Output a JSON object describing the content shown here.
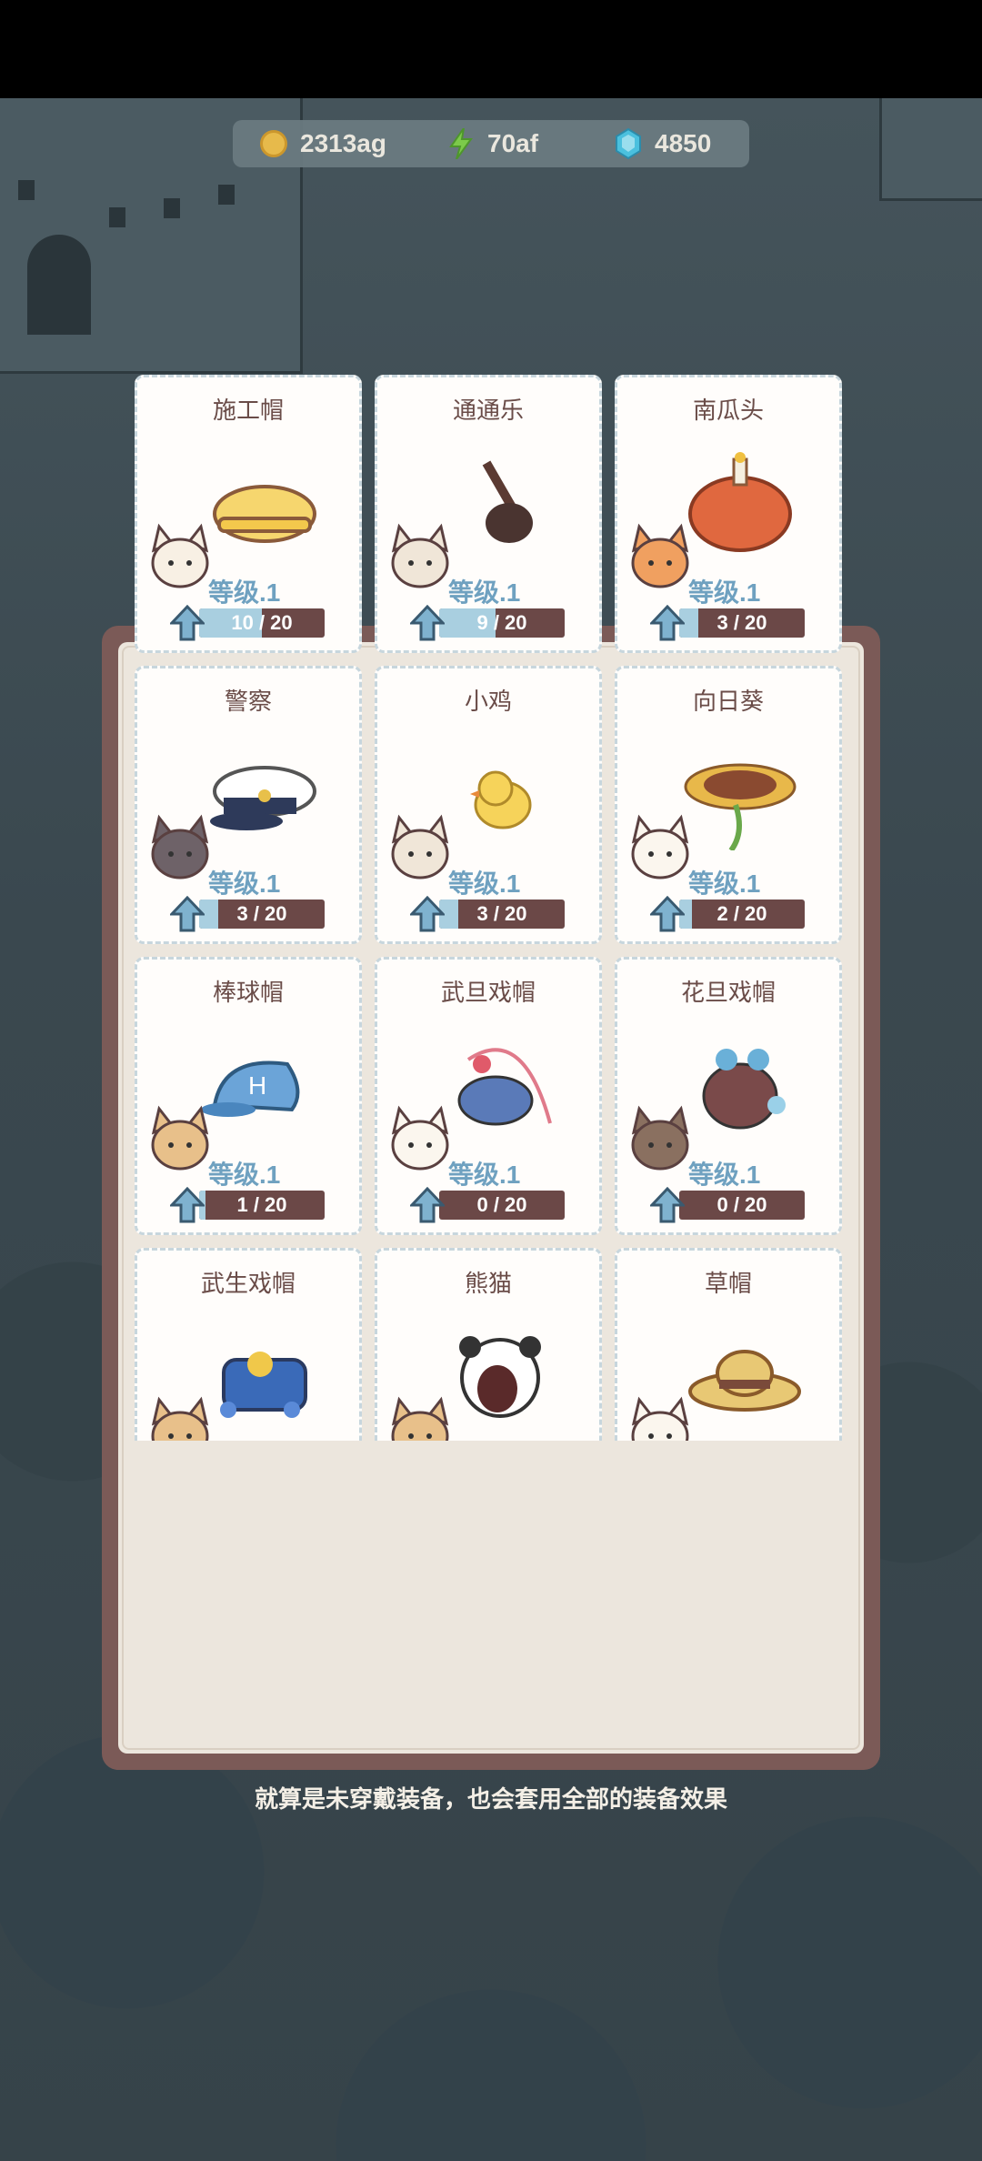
{
  "currency": {
    "coins": {
      "icon": "coin-icon",
      "value": "2313ag"
    },
    "energy": {
      "icon": "lightning-icon",
      "value": "70af"
    },
    "gems": {
      "icon": "gem-icon",
      "value": "4850"
    }
  },
  "items": [
    {
      "name": "施工帽",
      "level": "等级.1",
      "progress": "10 / 20",
      "fraction": 0.5,
      "hat": "hard-hat",
      "cat": "calico"
    },
    {
      "name": "通通乐",
      "level": "等级.1",
      "progress": "9 / 20",
      "fraction": 0.45,
      "hat": "plunger",
      "cat": "siamese"
    },
    {
      "name": "南瓜头",
      "level": "等级.1",
      "progress": "3 / 20",
      "fraction": 0.15,
      "hat": "pumpkin",
      "cat": "orange"
    },
    {
      "name": "警察",
      "level": "等级.1",
      "progress": "3 / 20",
      "fraction": 0.15,
      "hat": "police-cap",
      "cat": "gray"
    },
    {
      "name": "小鸡",
      "level": "等级.1",
      "progress": "3 / 20",
      "fraction": 0.15,
      "hat": "chick",
      "cat": "siamese"
    },
    {
      "name": "向日葵",
      "level": "等级.1",
      "progress": "2 / 20",
      "fraction": 0.1,
      "hat": "sunflower",
      "cat": "white"
    },
    {
      "name": "棒球帽",
      "level": "等级.1",
      "progress": "1 / 20",
      "fraction": 0.05,
      "hat": "baseball-cap",
      "cat": "tan"
    },
    {
      "name": "武旦戏帽",
      "level": "等级.1",
      "progress": "0 / 20",
      "fraction": 0,
      "hat": "opera-hat-wudan",
      "cat": "white"
    },
    {
      "name": "花旦戏帽",
      "level": "等级.1",
      "progress": "0 / 20",
      "fraction": 0,
      "hat": "opera-hat-huadan",
      "cat": "brown"
    },
    {
      "name": "武生戏帽",
      "hat": "opera-hat-wusheng",
      "cat": "tan"
    },
    {
      "name": "熊猫",
      "hat": "panda",
      "cat": "tan"
    },
    {
      "name": "草帽",
      "hat": "straw-hat",
      "cat": "white"
    }
  ],
  "footer": "就算是未穿戴装备，也会套用全部的装备效果"
}
